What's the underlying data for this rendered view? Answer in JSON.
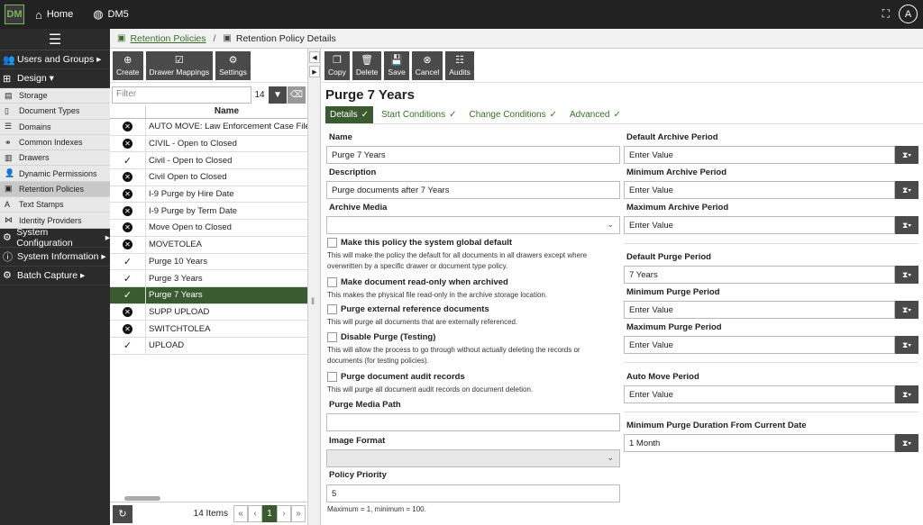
{
  "topbar": {
    "logo_text": "DM",
    "nav": [
      {
        "label": "Home",
        "icon": "home-icon"
      },
      {
        "label": "DM5",
        "icon": "globe-icon"
      }
    ],
    "avatar": "A"
  },
  "sidebar": {
    "groups": [
      {
        "label": "Users and Groups",
        "icon": "users-icon",
        "arrow": "▸"
      },
      {
        "label": "Design",
        "icon": "sitemap-icon",
        "arrow": "▾"
      }
    ],
    "design_items": [
      "Storage",
      "Document Types",
      "Domains",
      "Common Indexes",
      "Drawers",
      "Dynamic Permissions",
      "Retention Policies",
      "Text Stamps",
      "Identity Providers"
    ],
    "bottom_groups": [
      {
        "label": "System Configuration",
        "arrow": "▸"
      },
      {
        "label": "System Information",
        "arrow": "▸"
      },
      {
        "label": "Batch Capture",
        "arrow": "▸"
      }
    ]
  },
  "breadcrumb": {
    "parent": "Retention Policies",
    "current": "Retention Policy Details"
  },
  "left_toolbar": [
    "Create",
    "Drawer Mappings",
    "Settings"
  ],
  "filter": {
    "placeholder": "Filter",
    "count": "14"
  },
  "list": {
    "header": "Name",
    "rows": [
      {
        "name": "AUTO MOVE: Law Enforcement Case File",
        "status": "x"
      },
      {
        "name": "CIVIL - Open to Closed",
        "status": "x"
      },
      {
        "name": "Civil - Open to Closed",
        "status": "check"
      },
      {
        "name": "Civil Open to Closed",
        "status": "x"
      },
      {
        "name": "I-9 Purge by Hire Date",
        "status": "x"
      },
      {
        "name": "I-9 Purge by Term Date",
        "status": "x"
      },
      {
        "name": "Move Open to Closed",
        "status": "x"
      },
      {
        "name": "MOVETOLEA",
        "status": "x"
      },
      {
        "name": "Purge 10 Years",
        "status": "check"
      },
      {
        "name": "Purge 3 Years",
        "status": "check"
      },
      {
        "name": "Purge 7 Years",
        "status": "check",
        "selected": true
      },
      {
        "name": "SUPP UPLOAD",
        "status": "x"
      },
      {
        "name": "SWITCHTOLEA",
        "status": "x"
      },
      {
        "name": "UPLOAD",
        "status": "check"
      }
    ],
    "footer_items": "14 Items",
    "page": "1"
  },
  "right_toolbar": [
    "Copy",
    "Delete",
    "Save",
    "Cancel",
    "Audits"
  ],
  "details": {
    "title": "Purge 7 Years",
    "tabs": [
      "Details",
      "Start Conditions",
      "Change Conditions",
      "Advanced"
    ],
    "name_label": "Name",
    "name_value": "Purge 7 Years",
    "description_label": "Description",
    "description_value": "Purge documents after 7 Years",
    "archive_media_label": "Archive Media",
    "checkboxes": [
      {
        "label": "Make this policy the system global default",
        "help": "This will make the policy the default for all documents in all drawers except where overwritten by a specific drawer or document type policy."
      },
      {
        "label": "Make document read-only when archived",
        "help": "This makes the physical file read-only in the archive storage location."
      },
      {
        "label": "Purge external reference documents",
        "help": "This will purge all documents that are externally referenced."
      },
      {
        "label": "Disable Purge (Testing)",
        "help": "This will allow the process to go through without actually deleting the records or documents (for testing policies)."
      },
      {
        "label": "Purge document audit records",
        "help": "This will purge all document audit records on document deletion."
      }
    ],
    "purge_media_path_label": "Purge Media Path",
    "image_format_label": "Image Format",
    "policy_priority_label": "Policy Priority",
    "policy_priority_value": "5",
    "policy_priority_help": "Maximum = 1, minimum = 100.",
    "periods": [
      {
        "label": "Default Archive Period",
        "value": "Enter Value"
      },
      {
        "label": "Minimum Archive Period",
        "value": "Enter Value"
      },
      {
        "label": "Maximum Archive Period",
        "value": "Enter Value"
      },
      {
        "label": "Default Purge Period",
        "value": "7 Years"
      },
      {
        "label": "Minimum Purge Period",
        "value": "Enter Value"
      },
      {
        "label": "Maximum Purge Period",
        "value": "Enter Value"
      },
      {
        "label": "Auto Move Period",
        "value": "Enter Value"
      },
      {
        "label": "Minimum Purge Duration From Current Date",
        "value": "1 Month"
      }
    ]
  },
  "colors": {
    "accent": "#3a5a30",
    "link": "#3a6e2a",
    "dark": "#222222"
  }
}
